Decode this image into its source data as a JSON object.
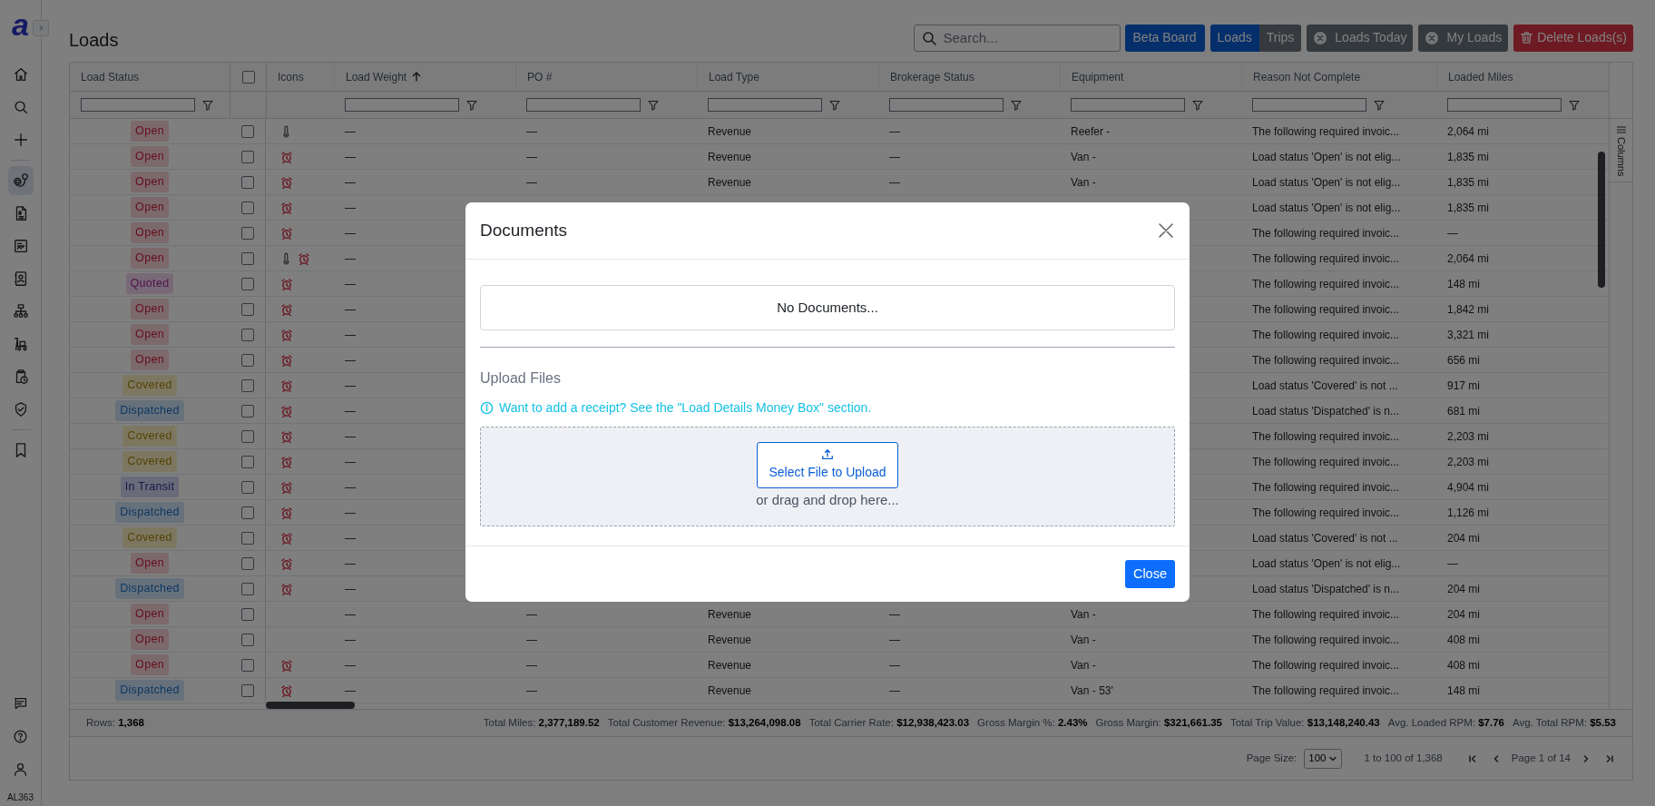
{
  "sidebar": {
    "logo": "a",
    "groups": [
      [
        {
          "kind": "home",
          "selected": false
        },
        {
          "kind": "search",
          "selected": false
        },
        {
          "kind": "plus",
          "selected": false
        }
      ],
      [
        {
          "kind": "route",
          "selected": true
        },
        {
          "kind": "invoice",
          "selected": false
        },
        {
          "kind": "report",
          "selected": false
        },
        {
          "kind": "contact",
          "selected": false
        },
        {
          "kind": "hierarchy",
          "selected": false
        },
        {
          "kind": "dolly",
          "selected": false
        },
        {
          "kind": "schedule",
          "selected": false
        },
        {
          "kind": "shield",
          "selected": false
        }
      ],
      [
        {
          "kind": "bookmark",
          "selected": false
        }
      ]
    ],
    "bottom": [
      {
        "kind": "chat"
      },
      {
        "kind": "help"
      },
      {
        "kind": "user"
      }
    ],
    "user_code": "AL363"
  },
  "page_title": "Loads",
  "toolbar": {
    "search_placeholder": "Search...",
    "beta_board": "Beta Board",
    "view_toggle": [
      {
        "label": "Loads",
        "selected": true
      },
      {
        "label": "Trips",
        "selected": false
      }
    ],
    "filters": [
      "Loads Today",
      "My Loads"
    ],
    "delete": "Delete Loads(s)"
  },
  "table": {
    "columns": [
      {
        "kind": "text",
        "label": "Load Status",
        "filter": true,
        "sorted_ascending": false
      },
      {
        "kind": "checkbox",
        "checked": false
      },
      {
        "kind": "text",
        "label": "Icons",
        "filter": false,
        "sorted_ascending": false
      },
      {
        "kind": "text",
        "label": "Load Weight",
        "sorted_ascending": true,
        "filter": true
      },
      {
        "kind": "text",
        "label": "PO #",
        "filter": true,
        "sorted_ascending": false
      },
      {
        "kind": "text",
        "label": "Load Type",
        "filter": true,
        "sorted_ascending": false
      },
      {
        "kind": "text",
        "label": "Brokerage Status",
        "filter": true,
        "sorted_ascending": false
      },
      {
        "kind": "text",
        "label": "Equipment",
        "filter": true,
        "sorted_ascending": false
      },
      {
        "kind": "text",
        "label": "Reason Not Complete",
        "filter": true,
        "sorted_ascending": false
      },
      {
        "kind": "text",
        "label": "Loaded Miles",
        "filter": true,
        "sorted_ascending": false
      }
    ],
    "columns_panel": "Columns",
    "rows": [
      {
        "status": "Open",
        "kind": "open",
        "checked": false,
        "refrigerated": true,
        "alert": false,
        "load_weight": "—",
        "po": "—",
        "load_type": "Revenue",
        "brokerage_status": "—",
        "equipment": "Reefer -",
        "reason": "The following required invoic...",
        "loaded_miles": "2,064 mi"
      },
      {
        "status": "Open",
        "kind": "open",
        "checked": false,
        "refrigerated": false,
        "alert": true,
        "load_weight": "—",
        "po": "—",
        "load_type": "Revenue",
        "brokerage_status": "—",
        "equipment": "Van -",
        "reason": "Load status 'Open' is not elig...",
        "loaded_miles": "1,835 mi"
      },
      {
        "status": "Open",
        "kind": "open",
        "checked": false,
        "refrigerated": false,
        "alert": true,
        "load_weight": "—",
        "po": "—",
        "load_type": "Revenue",
        "brokerage_status": "—",
        "equipment": "Van -",
        "reason": "Load status 'Open' is not elig...",
        "loaded_miles": "1,835 mi"
      },
      {
        "status": "Open",
        "kind": "open",
        "checked": false,
        "refrigerated": false,
        "alert": true,
        "load_weight": "—",
        "reason": "Load status 'Open' is not elig...",
        "loaded_miles": "1,835 mi"
      },
      {
        "status": "Open",
        "kind": "open",
        "checked": false,
        "refrigerated": false,
        "alert": true,
        "load_weight": "—",
        "reason": "The following required invoic...",
        "loaded_miles": "—"
      },
      {
        "status": "Open",
        "kind": "open",
        "checked": false,
        "refrigerated": true,
        "alert": true,
        "load_weight": "—",
        "reason": "The following required invoic...",
        "loaded_miles": "2,064 mi"
      },
      {
        "status": "Quoted",
        "kind": "quoted",
        "checked": false,
        "refrigerated": false,
        "alert": true,
        "load_weight": "—",
        "reason": "The following required invoic...",
        "loaded_miles": "148 mi"
      },
      {
        "status": "Open",
        "kind": "open",
        "checked": false,
        "refrigerated": false,
        "alert": true,
        "load_weight": "—",
        "reason": "The following required invoic...",
        "loaded_miles": "1,842 mi"
      },
      {
        "status": "Open",
        "kind": "open",
        "checked": false,
        "refrigerated": false,
        "alert": true,
        "load_weight": "—",
        "reason": "The following required invoic...",
        "loaded_miles": "3,321 mi"
      },
      {
        "status": "Open",
        "kind": "open",
        "checked": false,
        "refrigerated": false,
        "alert": true,
        "load_weight": "—",
        "reason": "The following required invoic...",
        "loaded_miles": "656 mi"
      },
      {
        "status": "Covered",
        "kind": "covered",
        "checked": false,
        "refrigerated": false,
        "alert": true,
        "load_weight": "—",
        "reason": "Load status 'Covered' is not ...",
        "loaded_miles": "917 mi"
      },
      {
        "status": "Dispatched",
        "kind": "dispatched",
        "checked": false,
        "refrigerated": false,
        "alert": true,
        "load_weight": "—",
        "reason": "Load status 'Dispatched' is n...",
        "loaded_miles": "681 mi"
      },
      {
        "status": "Covered",
        "kind": "covered",
        "checked": false,
        "refrigerated": false,
        "alert": true,
        "load_weight": "—",
        "reason": "The following required invoic...",
        "loaded_miles": "2,203 mi"
      },
      {
        "status": "Covered",
        "kind": "covered",
        "checked": false,
        "refrigerated": false,
        "alert": true,
        "load_weight": "—",
        "reason": "The following required invoic...",
        "loaded_miles": "2,203 mi"
      },
      {
        "status": "In Transit",
        "kind": "in_transit",
        "checked": false,
        "refrigerated": false,
        "alert": true,
        "load_weight": "—",
        "reason": "The following required invoic...",
        "loaded_miles": "4,904 mi"
      },
      {
        "status": "Dispatched",
        "kind": "dispatched",
        "checked": false,
        "refrigerated": false,
        "alert": true,
        "load_weight": "—",
        "reason": "The following required invoic...",
        "loaded_miles": "1,126 mi"
      },
      {
        "status": "Covered",
        "kind": "covered",
        "checked": false,
        "refrigerated": false,
        "alert": true,
        "load_weight": "—",
        "reason": "Load status 'Covered' is not ...",
        "loaded_miles": "204 mi"
      },
      {
        "status": "Open",
        "kind": "open",
        "checked": false,
        "refrigerated": false,
        "alert": true,
        "load_weight": "—",
        "reason": "Load status 'Open' is not elig...",
        "loaded_miles": "—"
      },
      {
        "status": "Dispatched",
        "kind": "dispatched",
        "checked": false,
        "refrigerated": false,
        "alert": true,
        "load_weight": "—",
        "reason": "Load status 'Dispatched' is n...",
        "loaded_miles": "204 mi"
      },
      {
        "status": "Open",
        "kind": "open",
        "checked": false,
        "refrigerated": false,
        "alert": false,
        "load_weight": "—",
        "po": "—",
        "load_type": "Revenue",
        "brokerage_status": "—",
        "equipment": "Van -",
        "reason": "The following required invoic...",
        "loaded_miles": "204 mi"
      },
      {
        "status": "Open",
        "kind": "open",
        "checked": false,
        "refrigerated": false,
        "alert": false,
        "load_weight": "—",
        "po": "—",
        "load_type": "Revenue",
        "brokerage_status": "—",
        "equipment": "Van -",
        "reason": "The following required invoic...",
        "loaded_miles": "408 mi"
      },
      {
        "status": "Open",
        "kind": "open",
        "checked": false,
        "refrigerated": false,
        "alert": true,
        "load_weight": "—",
        "po": "—",
        "load_type": "Revenue",
        "brokerage_status": "—",
        "equipment": "Van -",
        "reason": "The following required invoic...",
        "loaded_miles": "408 mi"
      },
      {
        "status": "Dispatched",
        "kind": "dispatched",
        "checked": false,
        "refrigerated": false,
        "alert": true,
        "load_weight": "—",
        "po": "—",
        "load_type": "Revenue",
        "brokerage_status": "—",
        "equipment": "Van - 53'",
        "reason": "The following required invoic...",
        "loaded_miles": "148 mi"
      }
    ],
    "summary": {
      "rows": {
        "label": "Rows:",
        "value": "1,368"
      },
      "totals": [
        {
          "label": "Total Miles:",
          "value": "2,377,189.52"
        },
        {
          "label": "Total Customer Revenue:",
          "value": "$13,264,098.08"
        },
        {
          "label": "Total Carrier Rate:",
          "value": "$12,938,423.03"
        },
        {
          "label": "Gross Margin %:",
          "value": "2.43%"
        },
        {
          "label": "Gross Margin:",
          "value": "$321,661.35"
        },
        {
          "label": "Total Trip Value:",
          "value": "$13,148,240.43"
        },
        {
          "label": "Avg. Loaded RPM:",
          "value": "$7.76"
        },
        {
          "label": "Avg. Total RPM:",
          "value": "$5.53"
        }
      ]
    },
    "pagination": {
      "page_size_label": "Page Size:",
      "page_size": "100",
      "range": "1 to 100 of 1,368",
      "page": "Page 1 of 14"
    }
  },
  "modal": {
    "title": "Documents",
    "empty": "No Documents...",
    "upload_title": "Upload Files",
    "info": "Want to add a receipt? See the \"Load Details Money Box\" section.",
    "upload_button": "Select File to Upload",
    "drop_hint": "or drag and drop here...",
    "close": "Close"
  }
}
